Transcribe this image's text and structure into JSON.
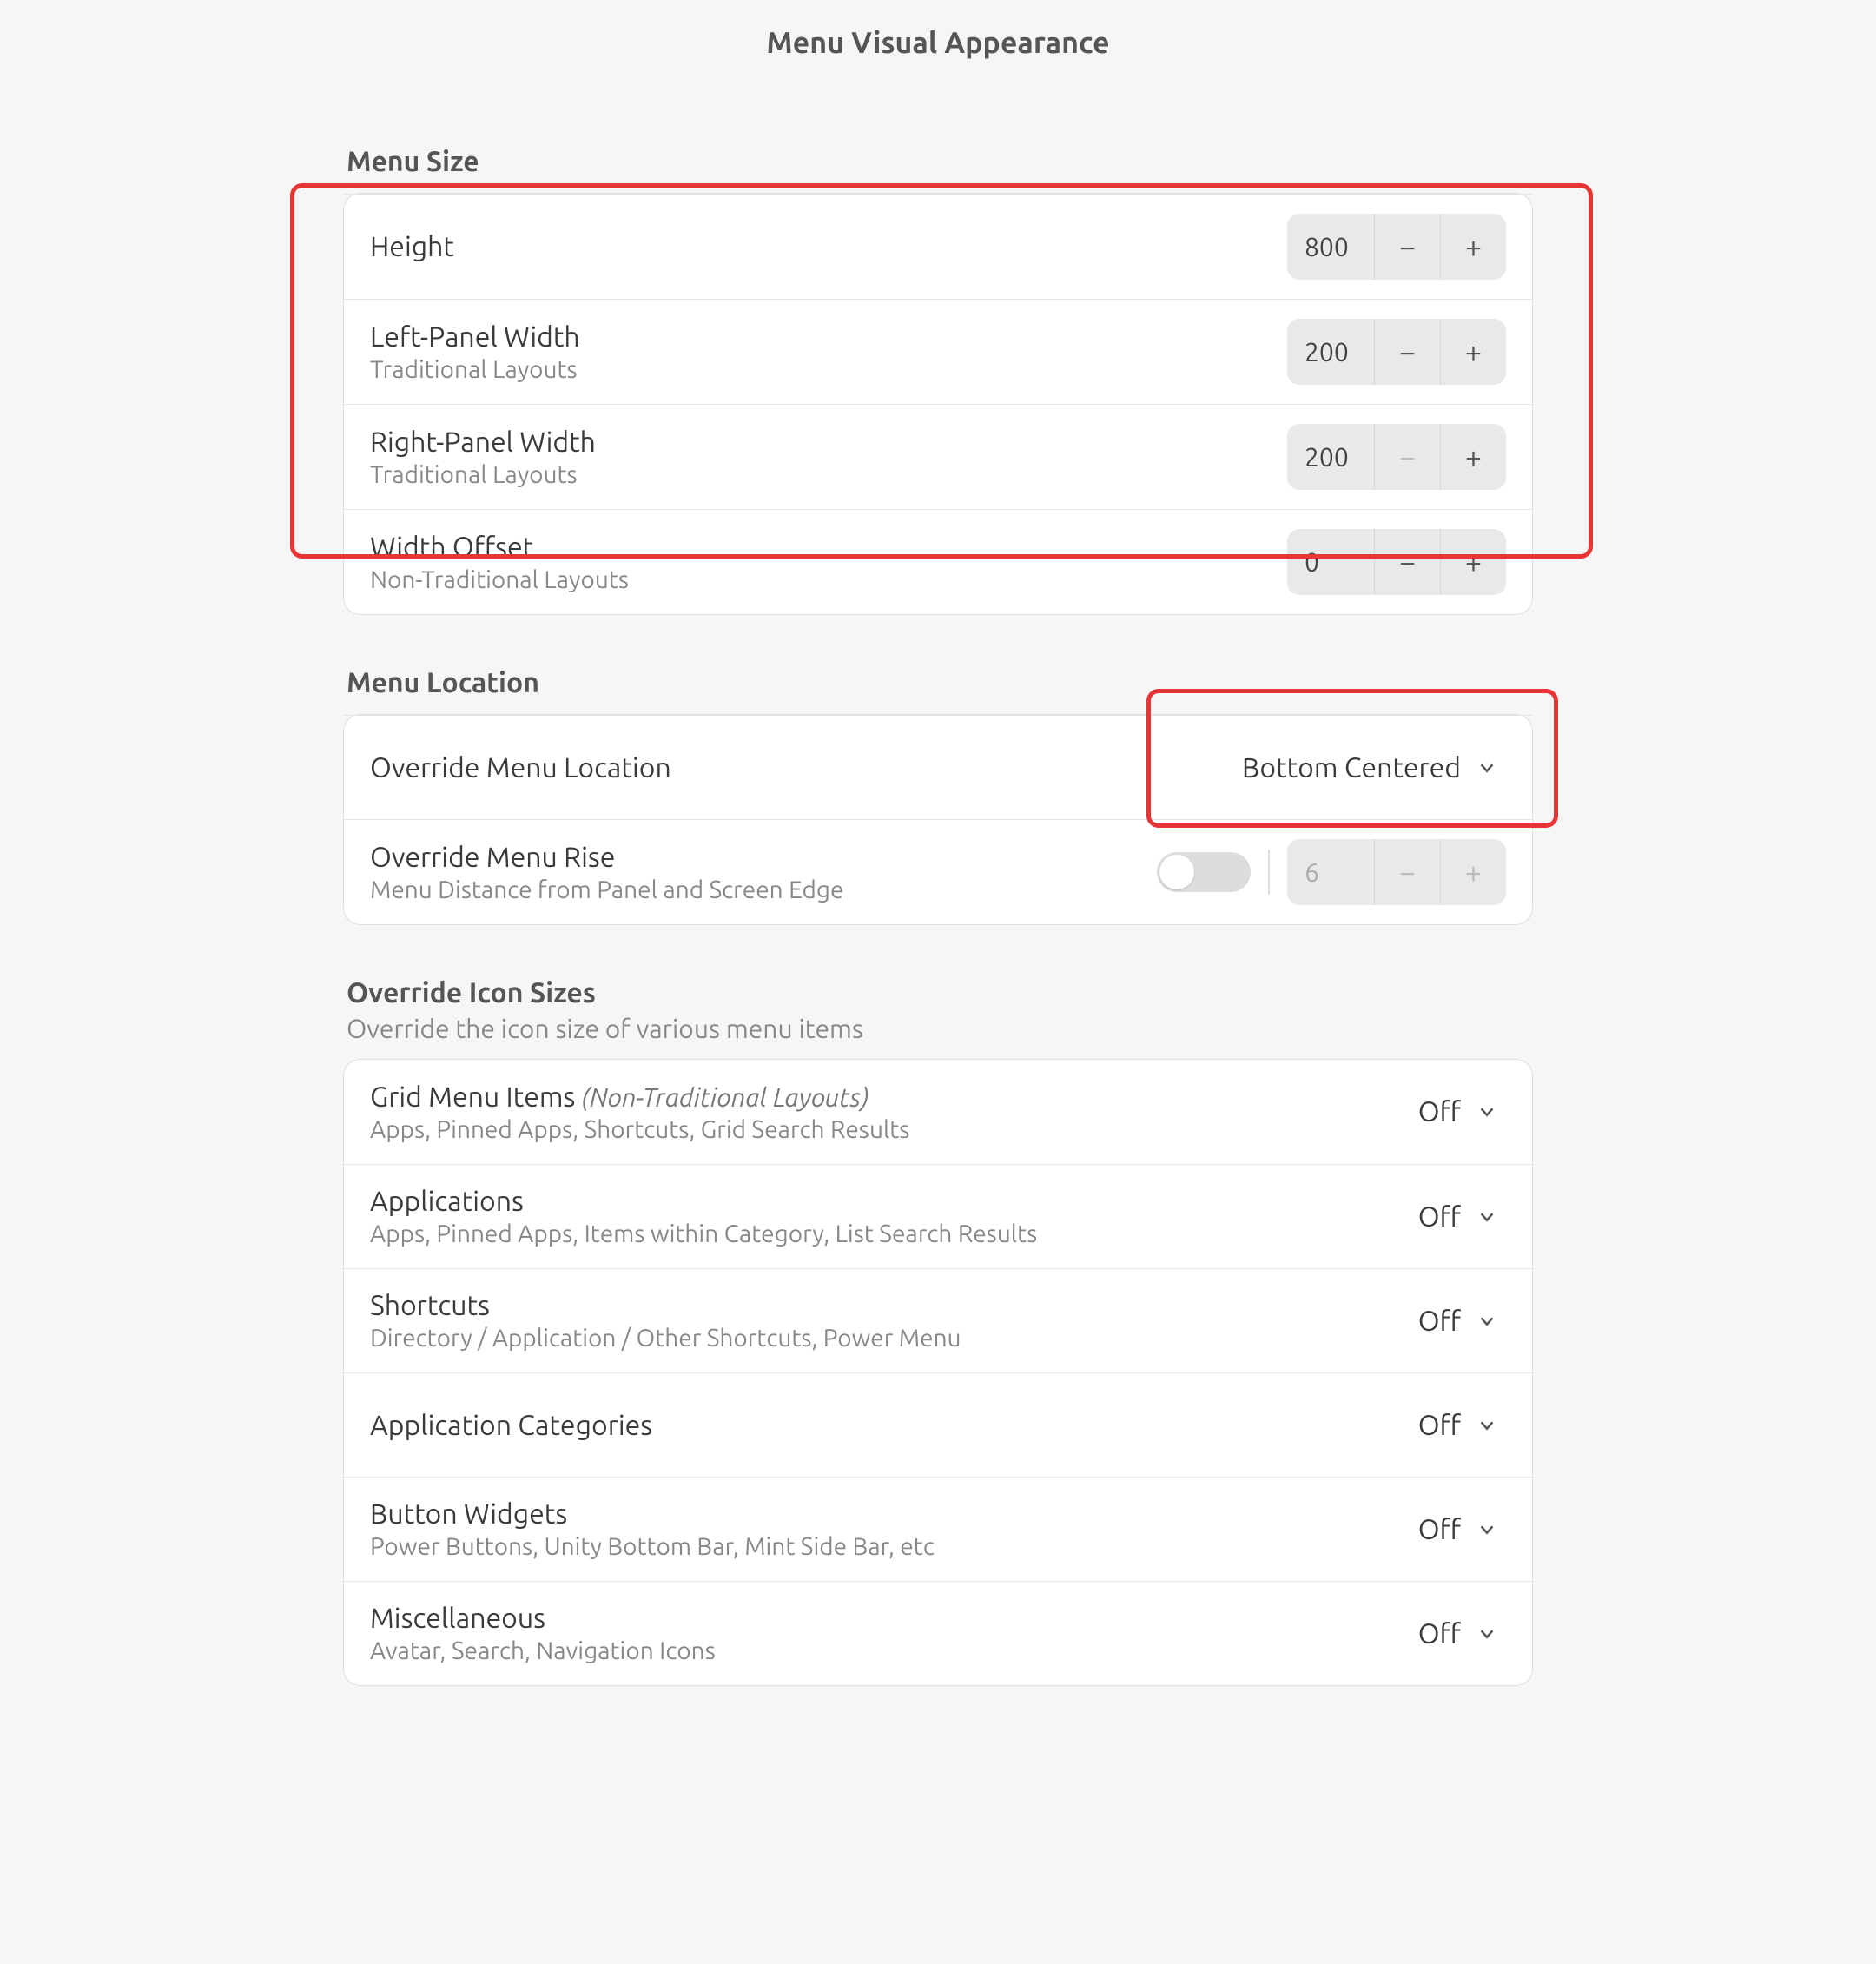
{
  "page_title": "Menu Visual Appearance",
  "menu_size": {
    "title": "Menu Size",
    "items": [
      {
        "label": "Height",
        "sub": "",
        "value": "800",
        "minus_disabled": false
      },
      {
        "label": "Left-Panel Width",
        "sub": "Traditional Layouts",
        "value": "200",
        "minus_disabled": false
      },
      {
        "label": "Right-Panel Width",
        "sub": "Traditional Layouts",
        "value": "200",
        "minus_disabled": true
      },
      {
        "label": "Width Offset",
        "sub": "Non-Traditional Layouts",
        "value": "0",
        "minus_disabled": false
      }
    ]
  },
  "menu_location": {
    "title": "Menu Location",
    "override_label": "Override Menu Location",
    "override_value": "Bottom Centered",
    "rise_label": "Override Menu Rise",
    "rise_sub": "Menu Distance from Panel and Screen Edge",
    "rise_value": "6",
    "rise_enabled": false
  },
  "icon_sizes": {
    "title": "Override Icon Sizes",
    "subtitle": "Override the icon size of various menu items",
    "off_label": "Off",
    "items": [
      {
        "label": "Grid Menu Items",
        "italic": " (Non-Traditional Layouts)",
        "sub": "Apps, Pinned Apps, Shortcuts, Grid Search Results",
        "value": "Off"
      },
      {
        "label": "Applications",
        "italic": "",
        "sub": "Apps, Pinned Apps, Items within Category, List Search Results",
        "value": "Off"
      },
      {
        "label": "Shortcuts",
        "italic": "",
        "sub": "Directory / Application / Other Shortcuts, Power Menu",
        "value": "Off"
      },
      {
        "label": "Application Categories",
        "italic": "",
        "sub": "",
        "value": "Off"
      },
      {
        "label": "Button Widgets",
        "italic": "",
        "sub": "Power Buttons, Unity Bottom Bar, Mint Side Bar, etc",
        "value": "Off"
      },
      {
        "label": "Miscellaneous",
        "italic": "",
        "sub": "Avatar, Search, Navigation Icons",
        "value": "Off"
      }
    ]
  }
}
